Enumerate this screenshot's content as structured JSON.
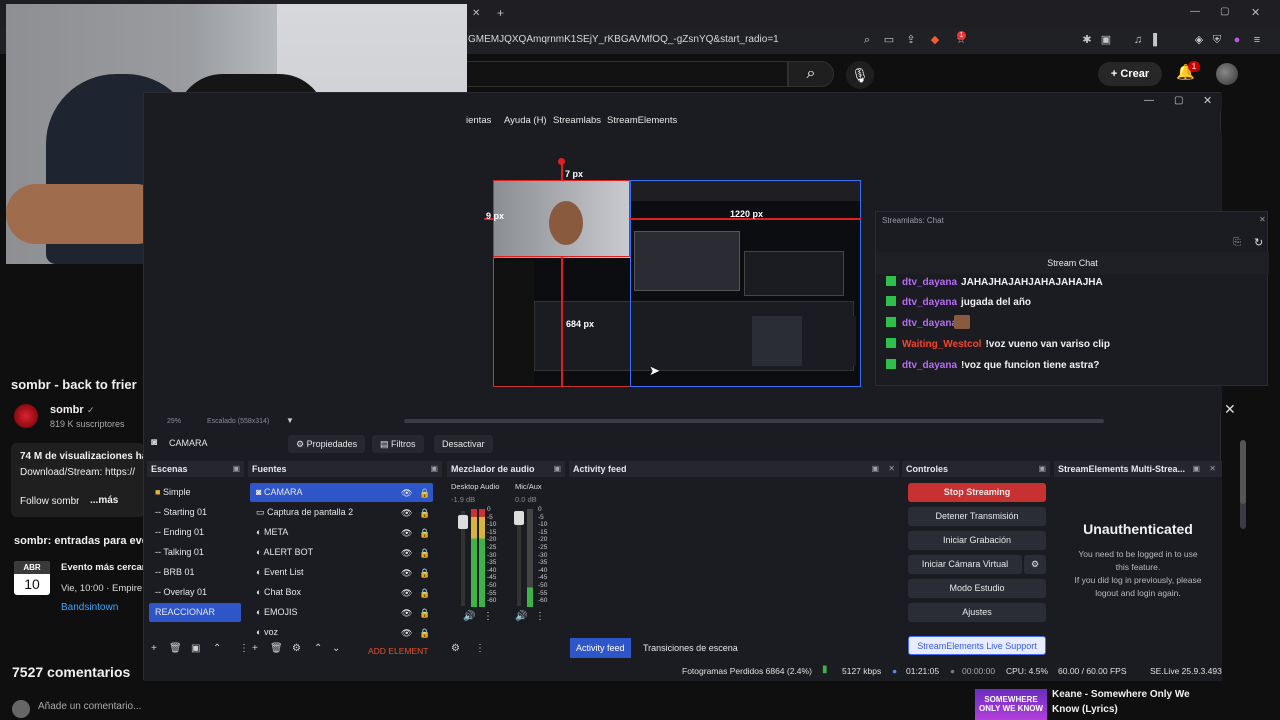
{
  "browser": {
    "url": "GMEMJQXQAmqrnmK1SEjY_rKBGAVMfOQ_-gZsnYQ&start_radio=1",
    "notification_count": "1"
  },
  "youtube": {
    "create_label": "Crear",
    "notification_count": "1",
    "video_title": "sombr - back to frier",
    "channel_name": "sombr",
    "subscribers": "819 K suscriptores",
    "views": "74 M de visualizaciones ha",
    "download_line": "Download/Stream: https://",
    "follow_line": "Follow sombr",
    "more": "...más",
    "tickets_heading": "sombr: entradas para eve",
    "event_month": "ABR",
    "event_day": "10",
    "event_title": "Evento más cercano",
    "event_time": "Vie, 10:00 · Empire",
    "event_source": "Bandsintown",
    "comments_count": "7527 comentarios",
    "add_comment_placeholder": "Añade un comentario...",
    "next_video_thumb_text": "SOMEWHERE ONLY WE KNOW",
    "next_video_title_1": "Keane - Somewhere Only We",
    "next_video_title_2": "Know (Lyrics)"
  },
  "obs": {
    "menu": [
      "ientas",
      "Ayuda (H)",
      "Streamlabs",
      "StreamElements"
    ],
    "px_labels": {
      "top": "7 px",
      "left": "9 px",
      "right": "1220 px",
      "bottom": "684 px"
    },
    "scale_text": "29%",
    "scaled_text": "Escalado (558x314)",
    "source_name": "CAMARA",
    "properties_label": "Propiedades",
    "filters_label": "Filtros",
    "disable_label": "Desactivar",
    "chat": {
      "dock_title": "Streamlabs: Chat",
      "header": "Stream Chat",
      "messages": [
        {
          "user": "dtv_dayana",
          "msg": "JAHAJHAJAHJAHAJAHAJHA",
          "color": "#b76cf2"
        },
        {
          "user": "dtv_dayana",
          "msg": "jugada del año",
          "color": "#b76cf2"
        },
        {
          "user": "dtv_dayana",
          "msg": "",
          "color": "#b76cf2"
        },
        {
          "user": "Waiting_Westcol",
          "msg": "!voz vueno van variso clip",
          "color": "#f0452e"
        },
        {
          "user": "dtv_dayana",
          "msg": "!voz que funcion tiene astra?",
          "color": "#b76cf2"
        }
      ]
    },
    "docks": {
      "scenes_title": "Escenas",
      "scenes": [
        "Simple",
        "-- Starting 01",
        "-- Ending 01",
        "-- Talking 01",
        "-- BRB 01",
        "-- Overlay 01",
        "REACCIONAR"
      ],
      "sources_title": "Fuentes",
      "sources": [
        "CAMARA",
        "Captura de pantalla 2",
        "META",
        "ALERT BOT",
        "Event List",
        "Chat Box",
        "EMOJIS",
        "voz"
      ],
      "add_element": "ADD ELEMENT",
      "mixer_title": "Mezclador de audio",
      "mixer_channels": [
        {
          "name": "Desktop Audio",
          "db": "-1.9 dB"
        },
        {
          "name": "Mic/Aux",
          "db": "0.0 dB"
        }
      ],
      "mixer_scale": [
        "0",
        "-5",
        "-10",
        "-15",
        "-20",
        "-25",
        "-30",
        "-35",
        "-40",
        "-45",
        "-50",
        "-55",
        "-60"
      ],
      "activity_title": "Activity feed",
      "activity_tab": "Activity feed",
      "transitions_tab": "Transiciones de escena",
      "controls_title": "Controles",
      "controls": [
        "Stop Streaming",
        "Detener Transmisión",
        "Iniciar Grabación",
        "Iniciar Cámara Virtual",
        "Modo Estudio",
        "Ajustes"
      ],
      "live_support": "StreamElements Live Support",
      "se_title": "StreamElements Multi-Strea...",
      "unauth_title": "Unauthenticated",
      "unauth_line1": "You need to be logged in to use",
      "unauth_line2": "this feature.",
      "unauth_line3": "If you did log in previously, please",
      "unauth_line4": "logout and login again."
    },
    "status": {
      "dropped": "Fotogramas Perdidos 6864 (2.4%)",
      "kbps": "5127 kbps",
      "live_time": "01:21:05",
      "rec_time": "00:00:00",
      "cpu": "CPU: 4.5%",
      "fps": "60.00 / 60.00 FPS",
      "version": "SE.Live 25.9.3.493"
    }
  },
  "colors": {
    "accent": "#2f56c9",
    "stop": "#c73131",
    "live_support": "#4a6cf0"
  }
}
